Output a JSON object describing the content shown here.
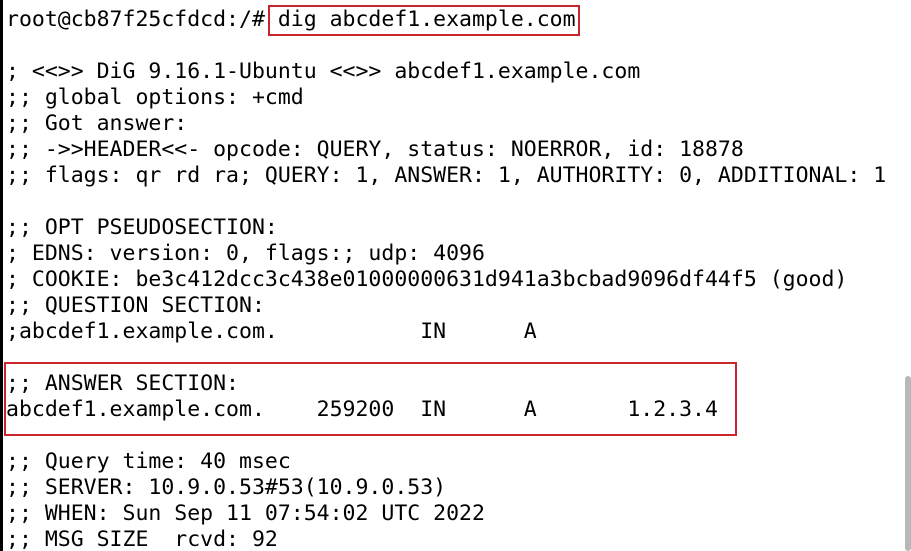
{
  "terminal": {
    "prompt": "root@cb87f25cfdcd:/# ",
    "command": "dig abcdef1.example.com",
    "lines": [
      "",
      "; <<>> DiG 9.16.1-Ubuntu <<>> abcdef1.example.com",
      ";; global options: +cmd",
      ";; Got answer:",
      ";; ->>HEADER<<- opcode: QUERY, status: NOERROR, id: 18878",
      ";; flags: qr rd ra; QUERY: 1, ANSWER: 1, AUTHORITY: 0, ADDITIONAL: 1",
      "",
      ";; OPT PSEUDOSECTION:",
      "; EDNS: version: 0, flags:; udp: 4096",
      "; COOKIE: be3c412dcc3c438e01000000631d941a3bcbad9096df44f5 (good)",
      ";; QUESTION SECTION:",
      ";abcdef1.example.com.           IN      A",
      "",
      ";; ANSWER SECTION:",
      "abcdef1.example.com.    259200  IN      A       1.2.3.4",
      "",
      ";; Query time: 40 msec",
      ";; SERVER: 10.9.0.53#53(10.9.0.53)",
      ";; WHEN: Sun Sep 11 07:54:02 UTC 2022",
      ";; MSG SIZE  rcvd: 92"
    ]
  },
  "colors": {
    "highlight_box": "#c8252c",
    "text": "#000000",
    "background": "#ffffff"
  }
}
